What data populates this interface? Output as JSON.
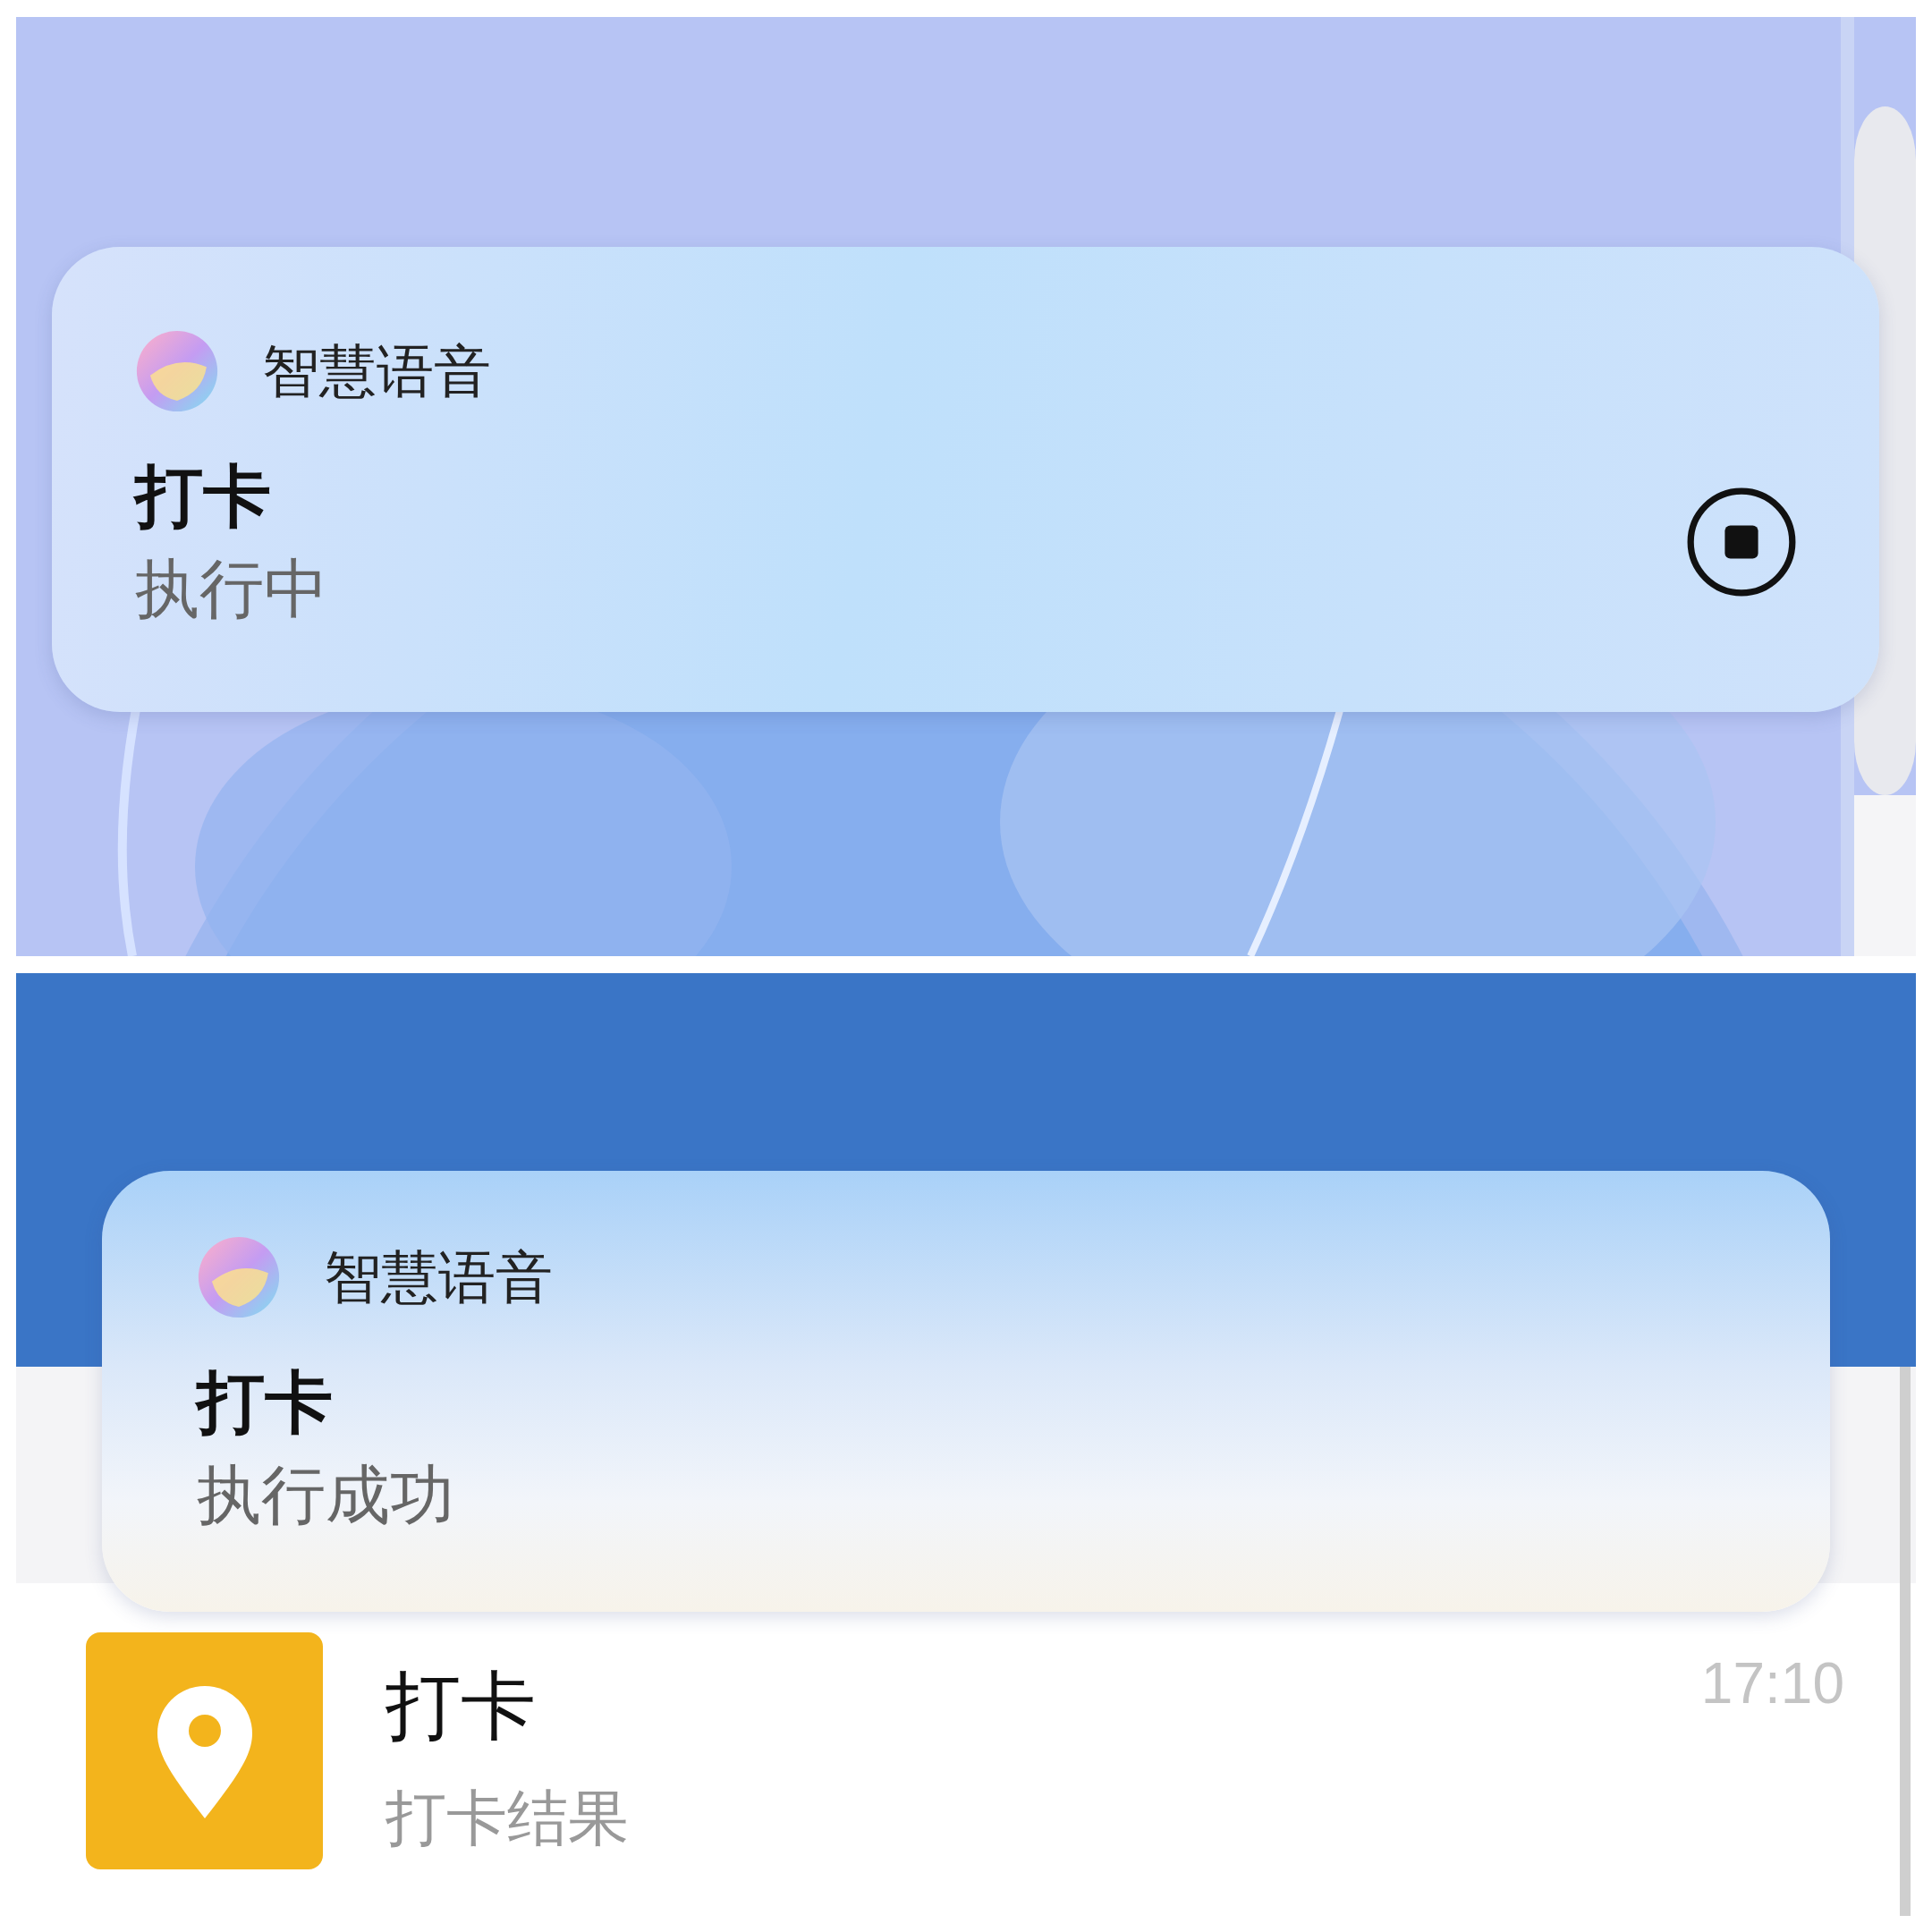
{
  "panels": [
    {
      "kind": "lock_screen",
      "notification": {
        "app_name": "智慧语音",
        "title": "打卡",
        "status": "执行中",
        "stop_button": true
      }
    },
    {
      "kind": "app",
      "notification": {
        "app_name": "智慧语音",
        "title": "打卡",
        "status": "执行成功",
        "stop_button": false
      },
      "list_items": [
        {
          "title": "打卡",
          "subtitle": "打卡结果",
          "time": "17:10"
        }
      ]
    }
  ]
}
